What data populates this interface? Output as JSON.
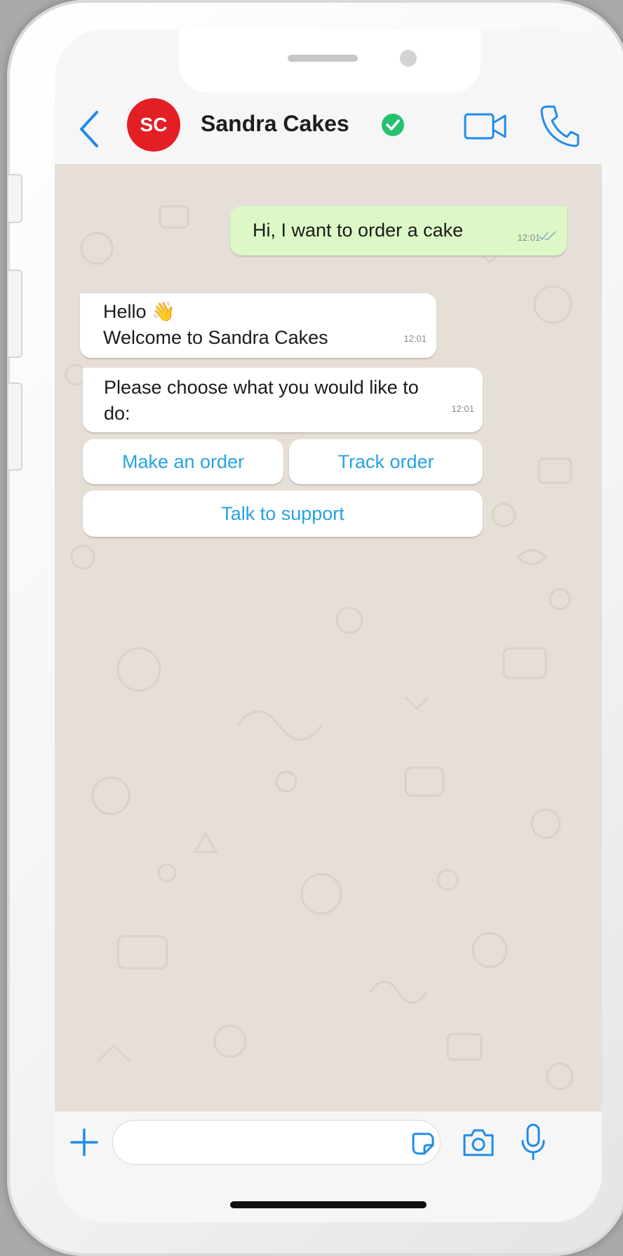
{
  "contact": {
    "initials": "SC",
    "name": "Sandra Cakes",
    "avatar_color": "#e31e24",
    "verified_color": "#25c16f"
  },
  "icons": {
    "back": "chevron-left-icon",
    "verified": "verified-check-icon",
    "video": "video-camera-icon",
    "call": "phone-icon",
    "plus": "plus-icon",
    "sticker": "sticker-icon",
    "camera": "camera-icon",
    "mic": "microphone-icon"
  },
  "messages": [
    {
      "direction": "outgoing",
      "text": "Hi, I want to order a cake",
      "time": "12:01",
      "status": "read"
    },
    {
      "direction": "incoming",
      "text": "Hello 👋\nWelcome to Sandra Cakes",
      "time": "12:01"
    },
    {
      "direction": "incoming",
      "text": "Please choose what you would like to do:",
      "time": "12:01"
    }
  ],
  "quick_replies": [
    {
      "label": "Make an order"
    },
    {
      "label": "Track order"
    },
    {
      "label": "Talk to support"
    }
  ],
  "composer": {
    "value": "",
    "placeholder": ""
  },
  "colors": {
    "accent": "#1f8bea",
    "outgoing_bubble": "#dcf8c6",
    "chat_background": "#e6dfd7",
    "quick_reply_text": "#27a3e0"
  }
}
